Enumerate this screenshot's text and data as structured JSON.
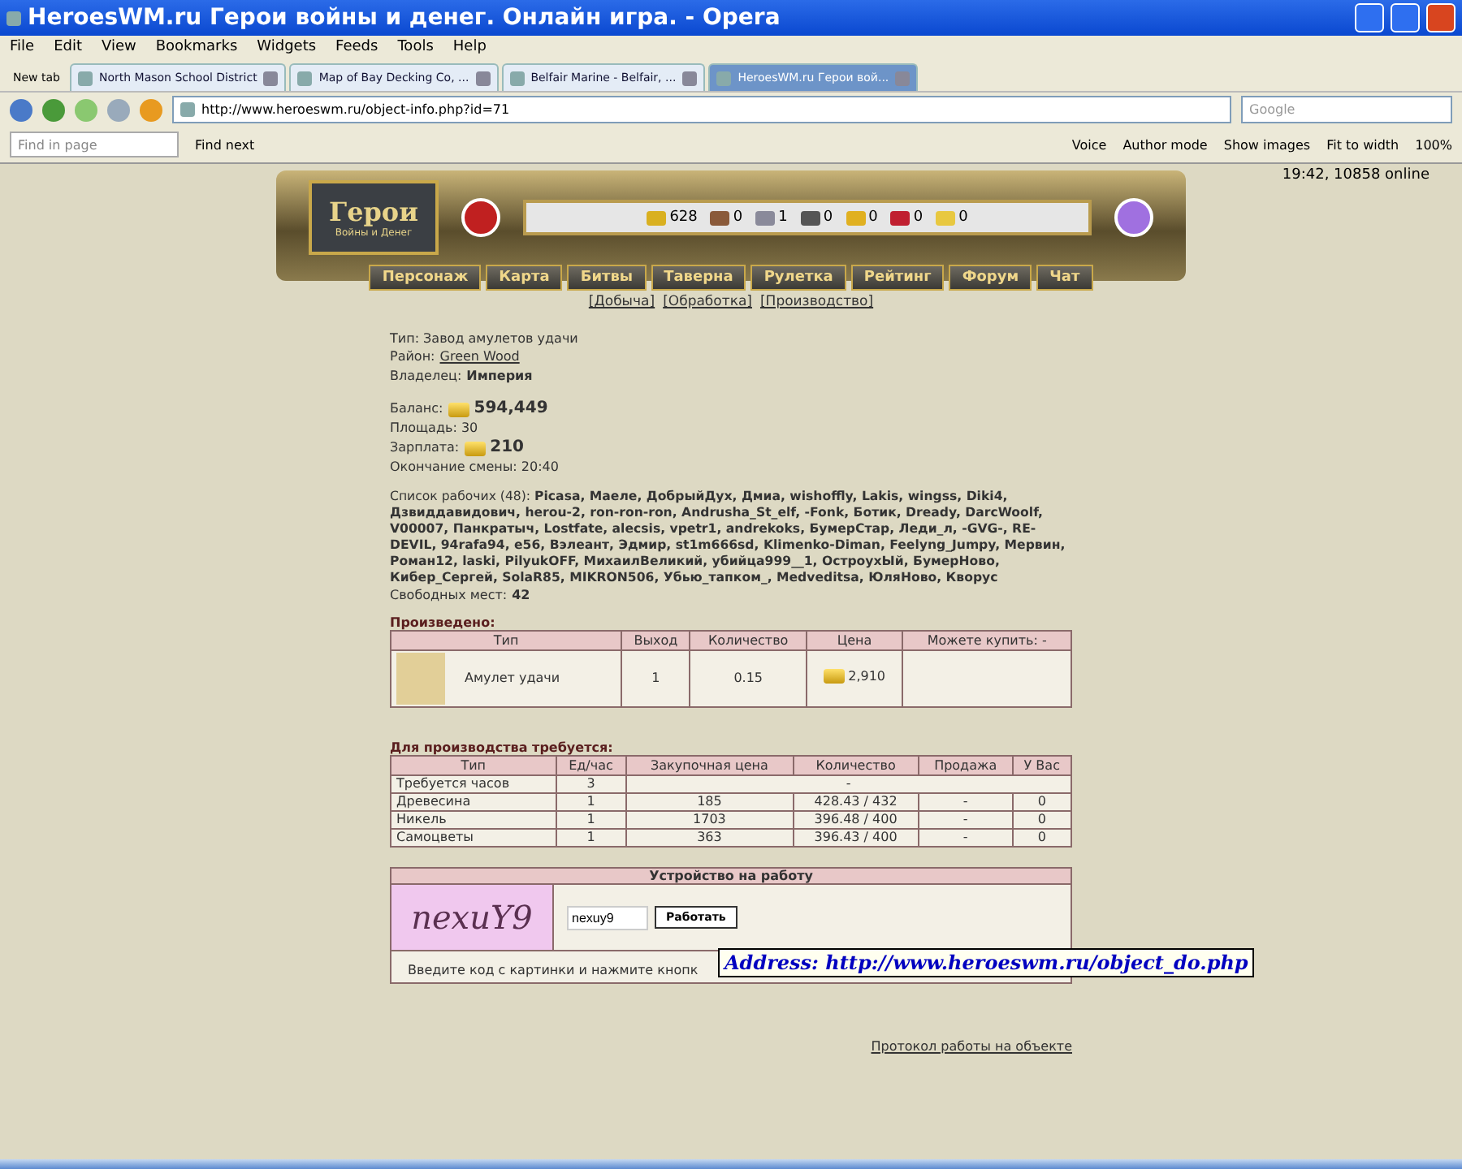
{
  "window": {
    "title": "HeroesWM.ru Герои войны и денег. Онлайн игра. - Opera"
  },
  "menu": [
    "File",
    "Edit",
    "View",
    "Bookmarks",
    "Widgets",
    "Feeds",
    "Tools",
    "Help"
  ],
  "tabs": [
    {
      "label": "New tab",
      "kind": "new",
      "selected": false
    },
    {
      "label": "North Mason School District",
      "kind": "page",
      "selected": false
    },
    {
      "label": "Map of Bay Decking Co, ...",
      "kind": "page",
      "selected": false
    },
    {
      "label": "Belfair Marine - Belfair, ...",
      "kind": "page",
      "selected": false
    },
    {
      "label": "HeroesWM.ru Герои вой...",
      "kind": "page",
      "selected": true
    }
  ],
  "address": {
    "value": "http://www.heroeswm.ru/object-info.php?id=71",
    "search_placeholder": "Google"
  },
  "find_bar": {
    "placeholder": "Find in page",
    "find_next": "Find next",
    "voice": "Voice",
    "author_mode": "Author mode",
    "show_images": "Show images",
    "fit_to_width": "Fit to width",
    "zoom": "100%"
  },
  "game_header": {
    "logo_title": "Герои",
    "logo_subtitle": "Войны и Денег",
    "online": "19:42, 10858 online",
    "resources": [
      "628",
      "0",
      "1",
      "0",
      "0",
      "0",
      "0"
    ],
    "nav": [
      "Персонаж",
      "Карта",
      "Битвы",
      "Таверна",
      "Рулетка",
      "Рейтинг",
      "Форум",
      "Чат"
    ]
  },
  "section_links": [
    "[Добыча]",
    "[Обработка]",
    "[Производство]"
  ],
  "info": {
    "type": "Тип: Завод амулетов удачи",
    "district_label": "Район:",
    "district": "Green Wood",
    "owner_label": "Владелец:",
    "owner": "Империя",
    "balance_label": "Баланс:",
    "balance": "594,449",
    "area": "Площадь: 30",
    "salary_label": "Зарплата:",
    "salary": "210",
    "shift_end": "Окончание смены: 20:40",
    "workers": "Список рабочих (48): **Picasa, Маеле, ДобрыйДух, Дмиа, wishoffly, Lakis, wingss, Diki4, Дзвиддавидович, herou-2, ron-ron-ron, Andrusha_St_elf, -Fonk, Ботик, Dready, DarcWoolf, V00007, Панкратыч, Lostfate, alecsis, vpetr1, andrekoks, БумерСтар, Леди_л, -GVG-, RE-DEVIL, 94rafa94, e56, Вэлеант, Эдмир, st1m666sd, Klimenko-Diman, Feelyng_Jumpy, Мервин, Роман12, laski, PilyukOFF, МихаилВеликий, убийца999__1, ОстроухЫй, БумерНово, Кибер_Сергей, SolaR85, MIKRON506, Убью_тапком_, Medveditsa, ЮляНово, Кворус**",
    "free_label": "Свободных мест:",
    "free": "42"
  },
  "produced": {
    "title": "Произведено:",
    "columns": [
      "Тип",
      "Выход",
      "Количество",
      "Цена",
      "Можете купить: -"
    ],
    "row": {
      "name": "Амулет удачи",
      "output": "1",
      "amount": "0.15",
      "price": "2,910"
    }
  },
  "required": {
    "title": "Для производства требуется:",
    "columns": [
      "Тип",
      "Ед/час",
      "Закупочная цена",
      "Количество",
      "Продажа",
      "У Вас"
    ],
    "hours_row": [
      "Требуется часов",
      "3",
      "-"
    ],
    "rows": [
      [
        "Древесина",
        "1",
        "185",
        "428.43 / 432",
        "-",
        "0"
      ],
      [
        "Никель",
        "1",
        "1703",
        "396.48 / 400",
        "-",
        "0"
      ],
      [
        "Самоцветы",
        "1",
        "363",
        "396.43 / 400",
        "-",
        "0"
      ]
    ]
  },
  "job": {
    "title": "Устройство на работу",
    "captcha": "nexuY9",
    "code": "nexuy9",
    "button": "Работать",
    "hint": "Введите код с картинки и нажмите кнопк"
  },
  "tooltip": "Address: http://www.heroeswm.ru/object_do.php",
  "log_link": "Протокол работы на объекте"
}
